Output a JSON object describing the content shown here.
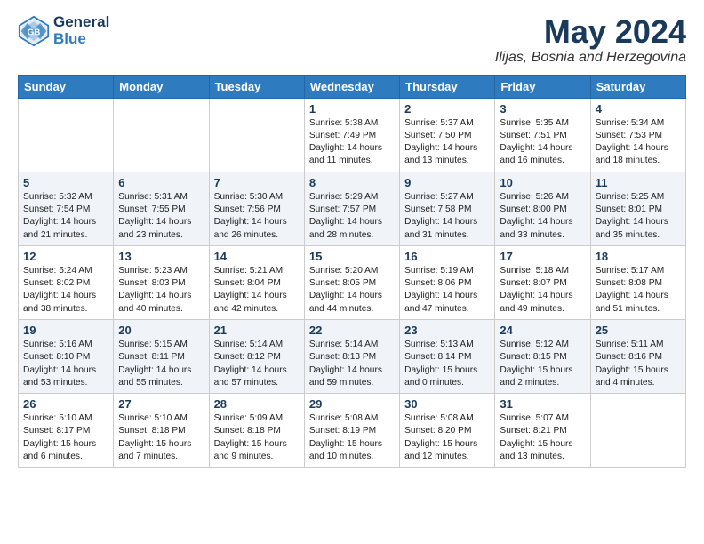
{
  "header": {
    "logo_line1": "General",
    "logo_line2": "Blue",
    "month": "May 2024",
    "location": "Ilijas, Bosnia and Herzegovina"
  },
  "weekdays": [
    "Sunday",
    "Monday",
    "Tuesday",
    "Wednesday",
    "Thursday",
    "Friday",
    "Saturday"
  ],
  "weeks": [
    [
      {
        "day": "",
        "info": ""
      },
      {
        "day": "",
        "info": ""
      },
      {
        "day": "",
        "info": ""
      },
      {
        "day": "1",
        "info": "Sunrise: 5:38 AM\nSunset: 7:49 PM\nDaylight: 14 hours\nand 11 minutes."
      },
      {
        "day": "2",
        "info": "Sunrise: 5:37 AM\nSunset: 7:50 PM\nDaylight: 14 hours\nand 13 minutes."
      },
      {
        "day": "3",
        "info": "Sunrise: 5:35 AM\nSunset: 7:51 PM\nDaylight: 14 hours\nand 16 minutes."
      },
      {
        "day": "4",
        "info": "Sunrise: 5:34 AM\nSunset: 7:53 PM\nDaylight: 14 hours\nand 18 minutes."
      }
    ],
    [
      {
        "day": "5",
        "info": "Sunrise: 5:32 AM\nSunset: 7:54 PM\nDaylight: 14 hours\nand 21 minutes."
      },
      {
        "day": "6",
        "info": "Sunrise: 5:31 AM\nSunset: 7:55 PM\nDaylight: 14 hours\nand 23 minutes."
      },
      {
        "day": "7",
        "info": "Sunrise: 5:30 AM\nSunset: 7:56 PM\nDaylight: 14 hours\nand 26 minutes."
      },
      {
        "day": "8",
        "info": "Sunrise: 5:29 AM\nSunset: 7:57 PM\nDaylight: 14 hours\nand 28 minutes."
      },
      {
        "day": "9",
        "info": "Sunrise: 5:27 AM\nSunset: 7:58 PM\nDaylight: 14 hours\nand 31 minutes."
      },
      {
        "day": "10",
        "info": "Sunrise: 5:26 AM\nSunset: 8:00 PM\nDaylight: 14 hours\nand 33 minutes."
      },
      {
        "day": "11",
        "info": "Sunrise: 5:25 AM\nSunset: 8:01 PM\nDaylight: 14 hours\nand 35 minutes."
      }
    ],
    [
      {
        "day": "12",
        "info": "Sunrise: 5:24 AM\nSunset: 8:02 PM\nDaylight: 14 hours\nand 38 minutes."
      },
      {
        "day": "13",
        "info": "Sunrise: 5:23 AM\nSunset: 8:03 PM\nDaylight: 14 hours\nand 40 minutes."
      },
      {
        "day": "14",
        "info": "Sunrise: 5:21 AM\nSunset: 8:04 PM\nDaylight: 14 hours\nand 42 minutes."
      },
      {
        "day": "15",
        "info": "Sunrise: 5:20 AM\nSunset: 8:05 PM\nDaylight: 14 hours\nand 44 minutes."
      },
      {
        "day": "16",
        "info": "Sunrise: 5:19 AM\nSunset: 8:06 PM\nDaylight: 14 hours\nand 47 minutes."
      },
      {
        "day": "17",
        "info": "Sunrise: 5:18 AM\nSunset: 8:07 PM\nDaylight: 14 hours\nand 49 minutes."
      },
      {
        "day": "18",
        "info": "Sunrise: 5:17 AM\nSunset: 8:08 PM\nDaylight: 14 hours\nand 51 minutes."
      }
    ],
    [
      {
        "day": "19",
        "info": "Sunrise: 5:16 AM\nSunset: 8:10 PM\nDaylight: 14 hours\nand 53 minutes."
      },
      {
        "day": "20",
        "info": "Sunrise: 5:15 AM\nSunset: 8:11 PM\nDaylight: 14 hours\nand 55 minutes."
      },
      {
        "day": "21",
        "info": "Sunrise: 5:14 AM\nSunset: 8:12 PM\nDaylight: 14 hours\nand 57 minutes."
      },
      {
        "day": "22",
        "info": "Sunrise: 5:14 AM\nSunset: 8:13 PM\nDaylight: 14 hours\nand 59 minutes."
      },
      {
        "day": "23",
        "info": "Sunrise: 5:13 AM\nSunset: 8:14 PM\nDaylight: 15 hours\nand 0 minutes."
      },
      {
        "day": "24",
        "info": "Sunrise: 5:12 AM\nSunset: 8:15 PM\nDaylight: 15 hours\nand 2 minutes."
      },
      {
        "day": "25",
        "info": "Sunrise: 5:11 AM\nSunset: 8:16 PM\nDaylight: 15 hours\nand 4 minutes."
      }
    ],
    [
      {
        "day": "26",
        "info": "Sunrise: 5:10 AM\nSunset: 8:17 PM\nDaylight: 15 hours\nand 6 minutes."
      },
      {
        "day": "27",
        "info": "Sunrise: 5:10 AM\nSunset: 8:18 PM\nDaylight: 15 hours\nand 7 minutes."
      },
      {
        "day": "28",
        "info": "Sunrise: 5:09 AM\nSunset: 8:18 PM\nDaylight: 15 hours\nand 9 minutes."
      },
      {
        "day": "29",
        "info": "Sunrise: 5:08 AM\nSunset: 8:19 PM\nDaylight: 15 hours\nand 10 minutes."
      },
      {
        "day": "30",
        "info": "Sunrise: 5:08 AM\nSunset: 8:20 PM\nDaylight: 15 hours\nand 12 minutes."
      },
      {
        "day": "31",
        "info": "Sunrise: 5:07 AM\nSunset: 8:21 PM\nDaylight: 15 hours\nand 13 minutes."
      },
      {
        "day": "",
        "info": ""
      }
    ]
  ]
}
